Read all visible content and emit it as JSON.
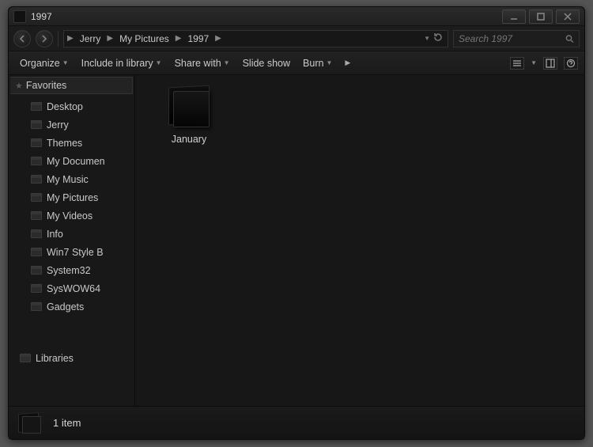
{
  "window": {
    "title": "1997"
  },
  "nav": {
    "back": true,
    "forward": true,
    "breadcrumb": [
      "Jerry",
      "My Pictures",
      "1997"
    ],
    "search_placeholder": "Search 1997"
  },
  "commandbar": {
    "organize": "Organize",
    "include": "Include in library",
    "share": "Share with",
    "slideshow": "Slide show",
    "burn": "Burn"
  },
  "sidebar": {
    "favorites_label": "Favorites",
    "items": [
      {
        "label": "Desktop"
      },
      {
        "label": "Jerry"
      },
      {
        "label": "Themes"
      },
      {
        "label": "My Documen"
      },
      {
        "label": "My Music"
      },
      {
        "label": "My Pictures"
      },
      {
        "label": "My Videos"
      },
      {
        "label": "Info"
      },
      {
        "label": "Win7 Style B"
      },
      {
        "label": "System32"
      },
      {
        "label": "SysWOW64"
      },
      {
        "label": "Gadgets"
      }
    ],
    "libraries_label": "Libraries"
  },
  "content": {
    "items": [
      {
        "name": "January",
        "type": "folder"
      }
    ]
  },
  "details": {
    "summary": "1 item"
  }
}
